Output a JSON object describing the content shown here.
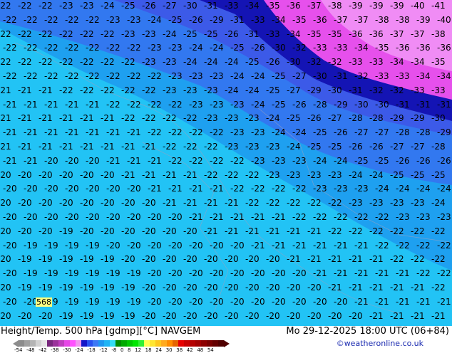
{
  "map": {
    "field_colors": {
      "cyan": "#22c3f5",
      "light_blue": "#1ea0f0",
      "blue": "#3278f0",
      "deep_blue": "#3c5ae8",
      "navy": "#1414b4",
      "magenta": "#e650ec",
      "pink": "#f08cf5"
    },
    "height_label": "568",
    "contour_rows": [
      [
        "-22",
        "-22",
        "-22",
        "-23",
        "-23",
        "-24",
        "-25",
        "-26",
        "-27",
        "-30",
        "-31",
        "-33",
        "-34",
        "-35",
        "-36",
        "-37",
        "-38",
        "-39",
        "-39",
        "-39",
        "-40",
        "-41"
      ],
      [
        "-22",
        "-22",
        "-22",
        "-22",
        "-22",
        "-23",
        "-23",
        "-24",
        "-25",
        "-26",
        "-29",
        "-31",
        "-33",
        "-34",
        "-35",
        "-36",
        "-37",
        "-37",
        "-38",
        "-38",
        "-39",
        "-40"
      ],
      [
        "-22",
        "-22",
        "-22",
        "-22",
        "-22",
        "-22",
        "-23",
        "-23",
        "-24",
        "-25",
        "-25",
        "-26",
        "-31",
        "-33",
        "-34",
        "-35",
        "-35",
        "-36",
        "-36",
        "-37",
        "-37",
        "-38"
      ],
      [
        "-22",
        "-22",
        "-22",
        "-22",
        "-22",
        "-22",
        "-22",
        "-23",
        "-23",
        "-24",
        "-24",
        "-25",
        "-26",
        "-30",
        "-32",
        "-33",
        "-33",
        "-34",
        "-35",
        "-36",
        "-36",
        "-36"
      ],
      [
        "-22",
        "-22",
        "-22",
        "-22",
        "-22",
        "-22",
        "-22",
        "-23",
        "-23",
        "-24",
        "-24",
        "-24",
        "-25",
        "-26",
        "-30",
        "-32",
        "-32",
        "-33",
        "-33",
        "-34",
        "-34",
        "-35"
      ],
      [
        "-22",
        "-22",
        "-22",
        "-22",
        "-22",
        "-22",
        "-22",
        "-22",
        "-23",
        "-23",
        "-23",
        "-24",
        "-24",
        "-25",
        "-27",
        "-30",
        "-31",
        "-32",
        "-33",
        "-33",
        "-34",
        "-34"
      ],
      [
        "-21",
        "-21",
        "-21",
        "-22",
        "-22",
        "-22",
        "-22",
        "-22",
        "-23",
        "-23",
        "-23",
        "-24",
        "-24",
        "-25",
        "-27",
        "-29",
        "-30",
        "-31",
        "-32",
        "-32",
        "-33",
        "-33"
      ],
      [
        "-21",
        "-21",
        "-21",
        "-21",
        "-21",
        "-22",
        "-22",
        "-22",
        "-22",
        "-23",
        "-23",
        "-23",
        "-24",
        "-25",
        "-26",
        "-28",
        "-29",
        "-30",
        "-30",
        "-31",
        "-31",
        "-31"
      ],
      [
        "-21",
        "-21",
        "-21",
        "-21",
        "-21",
        "-21",
        "-22",
        "-22",
        "-22",
        "-22",
        "-23",
        "-23",
        "-23",
        "-24",
        "-25",
        "-26",
        "-27",
        "-28",
        "-28",
        "-29",
        "-29",
        "-30"
      ],
      [
        "-21",
        "-21",
        "-21",
        "-21",
        "-21",
        "-21",
        "-21",
        "-22",
        "-22",
        "-22",
        "-22",
        "-23",
        "-23",
        "-24",
        "-24",
        "-25",
        "-26",
        "-27",
        "-27",
        "-28",
        "-28",
        "-29"
      ],
      [
        "-21",
        "-21",
        "-21",
        "-21",
        "-21",
        "-21",
        "-21",
        "-21",
        "-22",
        "-22",
        "-22",
        "-23",
        "-23",
        "-23",
        "-24",
        "-25",
        "-25",
        "-26",
        "-26",
        "-27",
        "-27",
        "-28"
      ],
      [
        "-21",
        "-21",
        "-20",
        "-20",
        "-20",
        "-21",
        "-21",
        "-21",
        "-22",
        "-22",
        "-22",
        "-22",
        "-23",
        "-23",
        "-23",
        "-24",
        "-24",
        "-25",
        "-25",
        "-26",
        "-26",
        "-26"
      ],
      [
        "-20",
        "-20",
        "-20",
        "-20",
        "-20",
        "-20",
        "-21",
        "-21",
        "-21",
        "-21",
        "-22",
        "-22",
        "-22",
        "-23",
        "-23",
        "-23",
        "-23",
        "-24",
        "-24",
        "-25",
        "-25",
        "-25"
      ],
      [
        "-20",
        "-20",
        "-20",
        "-20",
        "-20",
        "-20",
        "-20",
        "-21",
        "-21",
        "-21",
        "-21",
        "-22",
        "-22",
        "-22",
        "-22",
        "-23",
        "-23",
        "-23",
        "-24",
        "-24",
        "-24",
        "-24"
      ],
      [
        "-20",
        "-20",
        "-20",
        "-20",
        "-20",
        "-20",
        "-20",
        "-20",
        "-21",
        "-21",
        "-21",
        "-21",
        "-22",
        "-22",
        "-22",
        "-22",
        "-22",
        "-23",
        "-23",
        "-23",
        "-23",
        "-24"
      ],
      [
        "-20",
        "-20",
        "-20",
        "-20",
        "-20",
        "-20",
        "-20",
        "-20",
        "-20",
        "-21",
        "-21",
        "-21",
        "-21",
        "-21",
        "-22",
        "-22",
        "-22",
        "-22",
        "-22",
        "-23",
        "-23",
        "-23"
      ],
      [
        "-20",
        "-20",
        "-20",
        "-19",
        "-20",
        "-20",
        "-20",
        "-20",
        "-20",
        "-20",
        "-21",
        "-21",
        "-21",
        "-21",
        "-21",
        "-21",
        "-22",
        "-22",
        "-22",
        "-22",
        "-22",
        "-22"
      ],
      [
        "-20",
        "-19",
        "-19",
        "-19",
        "-19",
        "-20",
        "-20",
        "-20",
        "-20",
        "-20",
        "-20",
        "-20",
        "-21",
        "-21",
        "-21",
        "-21",
        "-21",
        "-21",
        "-22",
        "-22",
        "-22",
        "-22"
      ],
      [
        "-20",
        "-19",
        "-19",
        "-19",
        "-19",
        "-19",
        "-20",
        "-20",
        "-20",
        "-20",
        "-20",
        "-20",
        "-20",
        "-20",
        "-21",
        "-21",
        "-21",
        "-21",
        "-21",
        "-22",
        "-22",
        "-22"
      ],
      [
        "-20",
        "-19",
        "-19",
        "-19",
        "-19",
        "-19",
        "-19",
        "-20",
        "-20",
        "-20",
        "-20",
        "-20",
        "-20",
        "-20",
        "-20",
        "-21",
        "-21",
        "-21",
        "-21",
        "-21",
        "-22",
        "-22"
      ],
      [
        "-20",
        "-19",
        "-19",
        "-19",
        "-19",
        "-19",
        "-19",
        "-20",
        "-20",
        "-20",
        "-20",
        "-20",
        "-20",
        "-20",
        "-20",
        "-20",
        "-21",
        "-21",
        "-21",
        "-21",
        "-21",
        "-22"
      ],
      [
        "-20",
        "-20",
        "-19",
        "-19",
        "-19",
        "-19",
        "-19",
        "-20",
        "-20",
        "-20",
        "-20",
        "-20",
        "-20",
        "-20",
        "-20",
        "-20",
        "-20",
        "-21",
        "-21",
        "-21",
        "-21",
        "-21"
      ],
      [
        "-20",
        "-20",
        "-20",
        "-19",
        "-19",
        "-19",
        "-19",
        "-20",
        "-20",
        "-20",
        "-20",
        "-20",
        "-20",
        "-20",
        "-20",
        "-20",
        "-20",
        "-20",
        "-21",
        "-21",
        "-21",
        "-21"
      ]
    ]
  },
  "footer": {
    "title": "Height/Temp. 500 hPa [gdmp][°C] NAVGEM",
    "datetime": "Mo 29-12-2025 18:00 UTC (06+84)",
    "credit": "©weatheronline.co.uk",
    "legend_colors": [
      "#8c8c8c",
      "#a0a0a0",
      "#b4b4b4",
      "#d2d2d2",
      "#e6e6e6",
      "#78287d",
      "#9b329b",
      "#be3cbe",
      "#e646e6",
      "#ff50ff",
      "#f096f0",
      "#1414c8",
      "#2850f0",
      "#3c78f5",
      "#1e96f0",
      "#1eb4f5",
      "#32dcf5",
      "#008c00",
      "#00aa00",
      "#00c800",
      "#00e600",
      "#32f032",
      "#ffff50",
      "#ffe632",
      "#ffc81e",
      "#ffaa1e",
      "#ff8c00",
      "#e66400",
      "#e60000",
      "#c80000",
      "#b40000",
      "#a00000",
      "#8c0000",
      "#780000",
      "#640000",
      "#500000"
    ],
    "legend_ticks": [
      "-54",
      "-48",
      "-42",
      "-38",
      "-30",
      "-24",
      "-18",
      "-12",
      "-8",
      "0",
      "8",
      "12",
      "18",
      "24",
      "30",
      "38",
      "42",
      "48",
      "54"
    ]
  }
}
